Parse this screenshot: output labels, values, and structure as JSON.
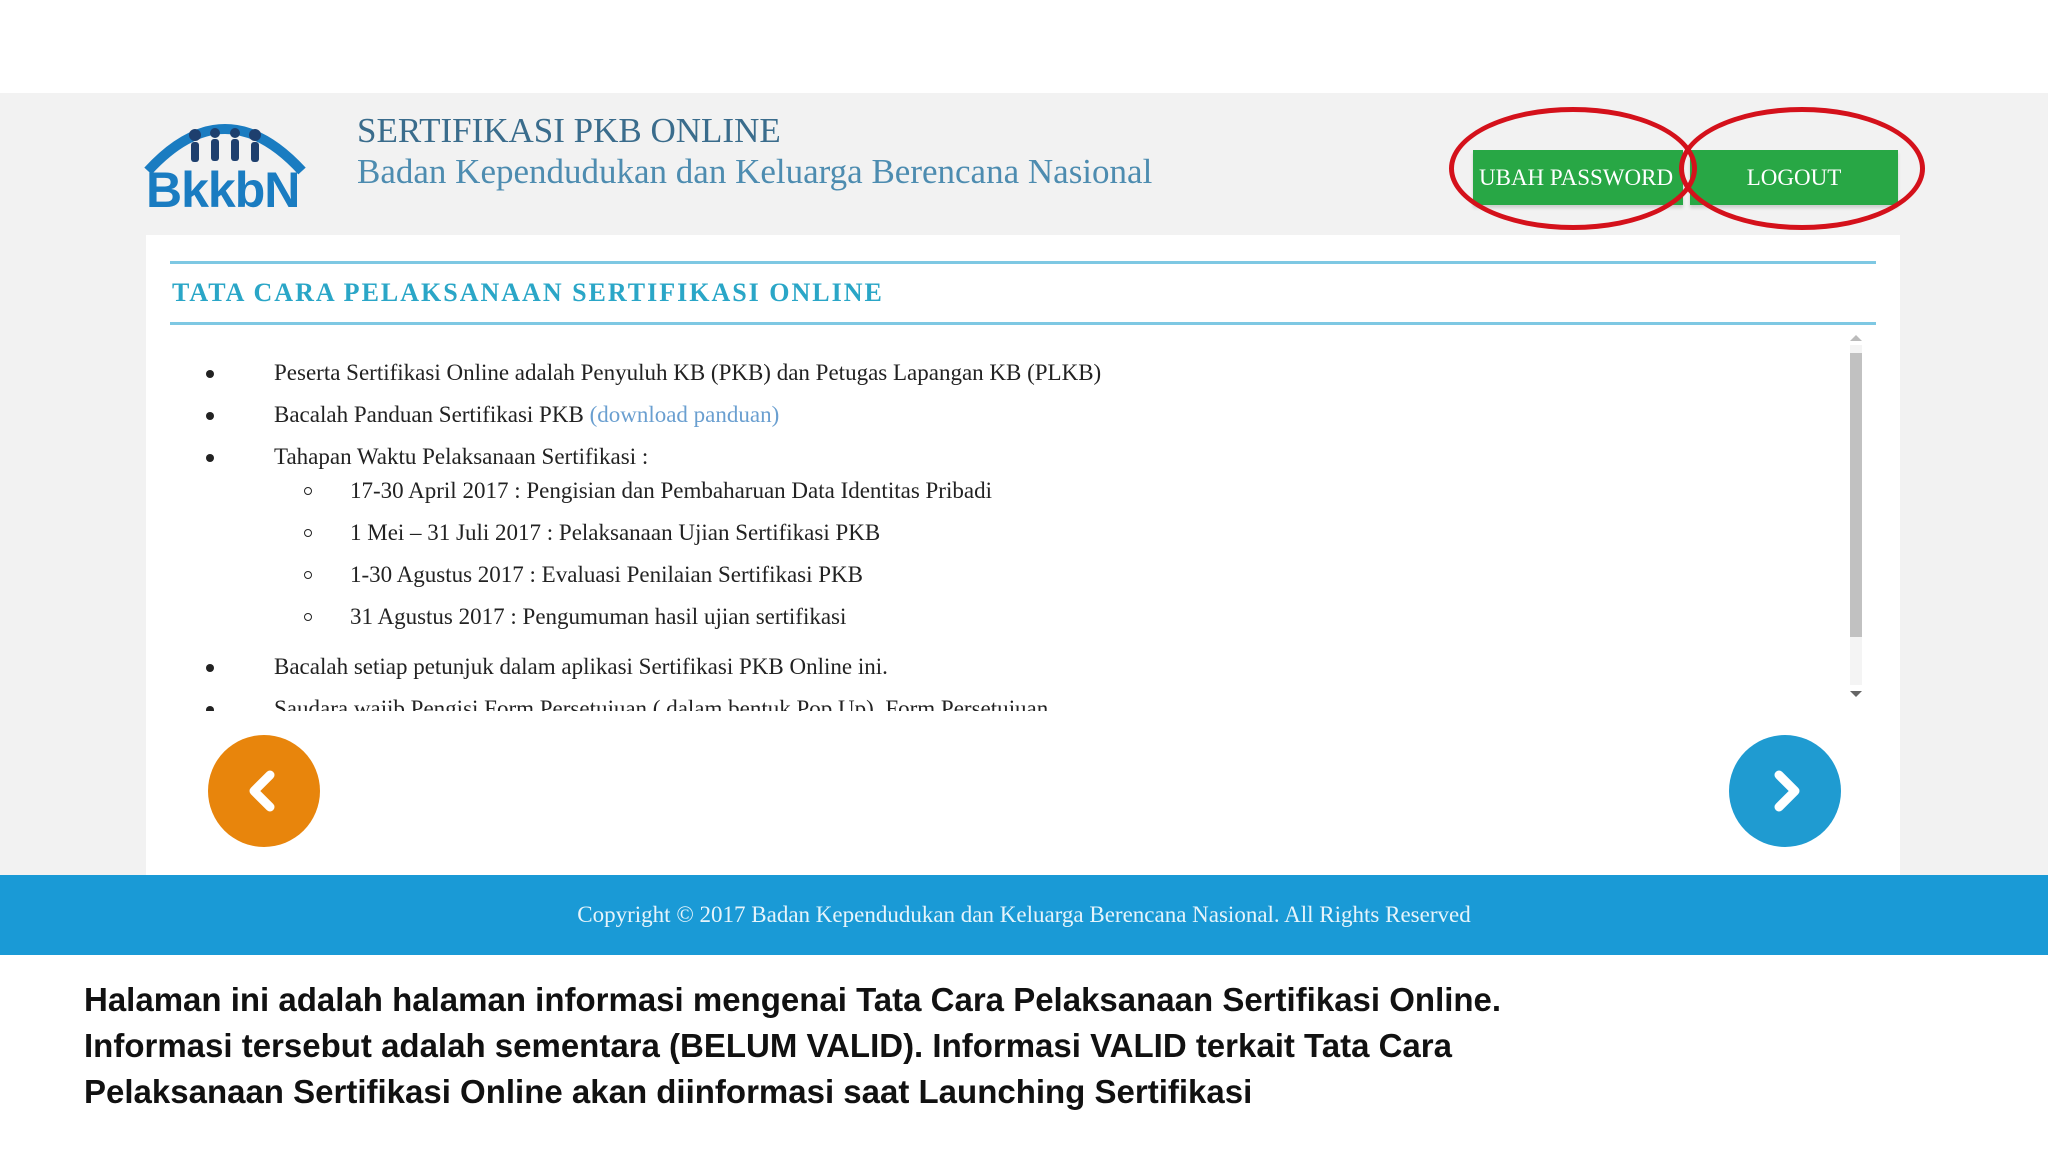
{
  "header": {
    "logo_text": "BkkbN",
    "title": "SERTIFIKASI PKB ONLINE",
    "subtitle": "Badan Kependudukan dan Keluarga Berencana Nasional",
    "buttons": {
      "change_password": "UBAH PASSWORD",
      "logout": "LOGOUT"
    }
  },
  "section": {
    "title": "TATA CARA PELAKSANAAN SERTIFIKASI ONLINE",
    "items": [
      "Peserta Sertifikasi Online adalah Penyuluh KB (PKB) dan Petugas Lapangan KB (PLKB)",
      "Bacalah Panduan Sertifikasi PKB",
      "Tahapan Waktu Pelaksanaan Sertifikasi :",
      "Bacalah setiap petunjuk dalam aplikasi Sertifikasi PKB Online ini.",
      "Saudara wajib Pengisi Form Persetujuan ( dalam bentuk Pop Up). Form Persetujuan"
    ],
    "download_link": "(download panduan)",
    "schedule": [
      "17-30 April 2017 : Pengisian dan Pembaharuan Data Identitas Pribadi",
      "1 Mei – 31 Juli 2017 : Pelaksanaan Ujian Sertifikasi PKB",
      "1-30 Agustus 2017 : Evaluasi Penilaian Sertifikasi PKB",
      "31 Agustus 2017 : Pengumuman hasil ujian sertifikasi"
    ]
  },
  "navigation": {
    "prev_icon": "chevron-left-icon",
    "next_icon": "chevron-right-icon",
    "prev_color": "#e8850c",
    "next_color": "#1f9bd1"
  },
  "footer": {
    "copyright": "Copyright © 2017 Badan Kependudukan dan Keluarga Berencana Nasional. All Rights Reserved"
  },
  "caption": {
    "lines": [
      "Halaman ini adalah halaman informasi mengenai Tata Cara Pelaksanaan Sertifikasi Online.",
      "Informasi tersebut adalah sementara (BELUM VALID). Informasi VALID terkait Tata Cara",
      "Pelaksanaan Sertifikasi Online akan diinformasi saat Launching Sertifikasi"
    ]
  },
  "colors": {
    "header_title": "#3a6c8c",
    "section_title": "#2aa6c7",
    "button_green": "#28a745",
    "footer_blue": "#1a9ad6",
    "highlight_ring": "#d4111b"
  }
}
